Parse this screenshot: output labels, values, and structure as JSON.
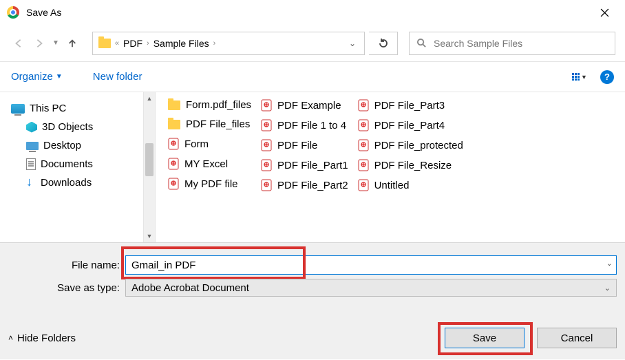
{
  "title": "Save As",
  "breadcrumb": {
    "prefix": "«",
    "items": [
      "PDF",
      "Sample Files"
    ]
  },
  "search": {
    "placeholder": "Search Sample Files"
  },
  "toolbar": {
    "organize": "Organize",
    "newfolder": "New folder"
  },
  "tree": {
    "thispc": "This PC",
    "threed": "3D Objects",
    "desktop": "Desktop",
    "documents": "Documents",
    "downloads": "Downloads"
  },
  "files": {
    "col1": [
      {
        "kind": "folder",
        "name": "Form.pdf_files"
      },
      {
        "kind": "folder",
        "name": "PDF File_files"
      },
      {
        "kind": "pdf",
        "name": "Form"
      },
      {
        "kind": "pdf",
        "name": "MY Excel"
      },
      {
        "kind": "pdf",
        "name": "My PDF file"
      }
    ],
    "col2": [
      {
        "kind": "pdf",
        "name": "PDF Example"
      },
      {
        "kind": "pdf",
        "name": "PDF File 1 to 4"
      },
      {
        "kind": "pdf",
        "name": "PDF File"
      },
      {
        "kind": "pdf",
        "name": "PDF File_Part1"
      },
      {
        "kind": "pdf",
        "name": "PDF File_Part2"
      }
    ],
    "col3": [
      {
        "kind": "pdf",
        "name": "PDF File_Part3"
      },
      {
        "kind": "pdf",
        "name": "PDF File_Part4"
      },
      {
        "kind": "pdf",
        "name": "PDF File_protected"
      },
      {
        "kind": "pdf",
        "name": "PDF File_Resize"
      },
      {
        "kind": "pdf",
        "name": "Untitled"
      }
    ]
  },
  "form": {
    "filename_label": "File name:",
    "filename_value": "Gmail_in PDF",
    "type_label": "Save as type:",
    "type_value": "Adobe Acrobat Document",
    "hide_folders": "Hide Folders",
    "save": "Save",
    "cancel": "Cancel"
  }
}
